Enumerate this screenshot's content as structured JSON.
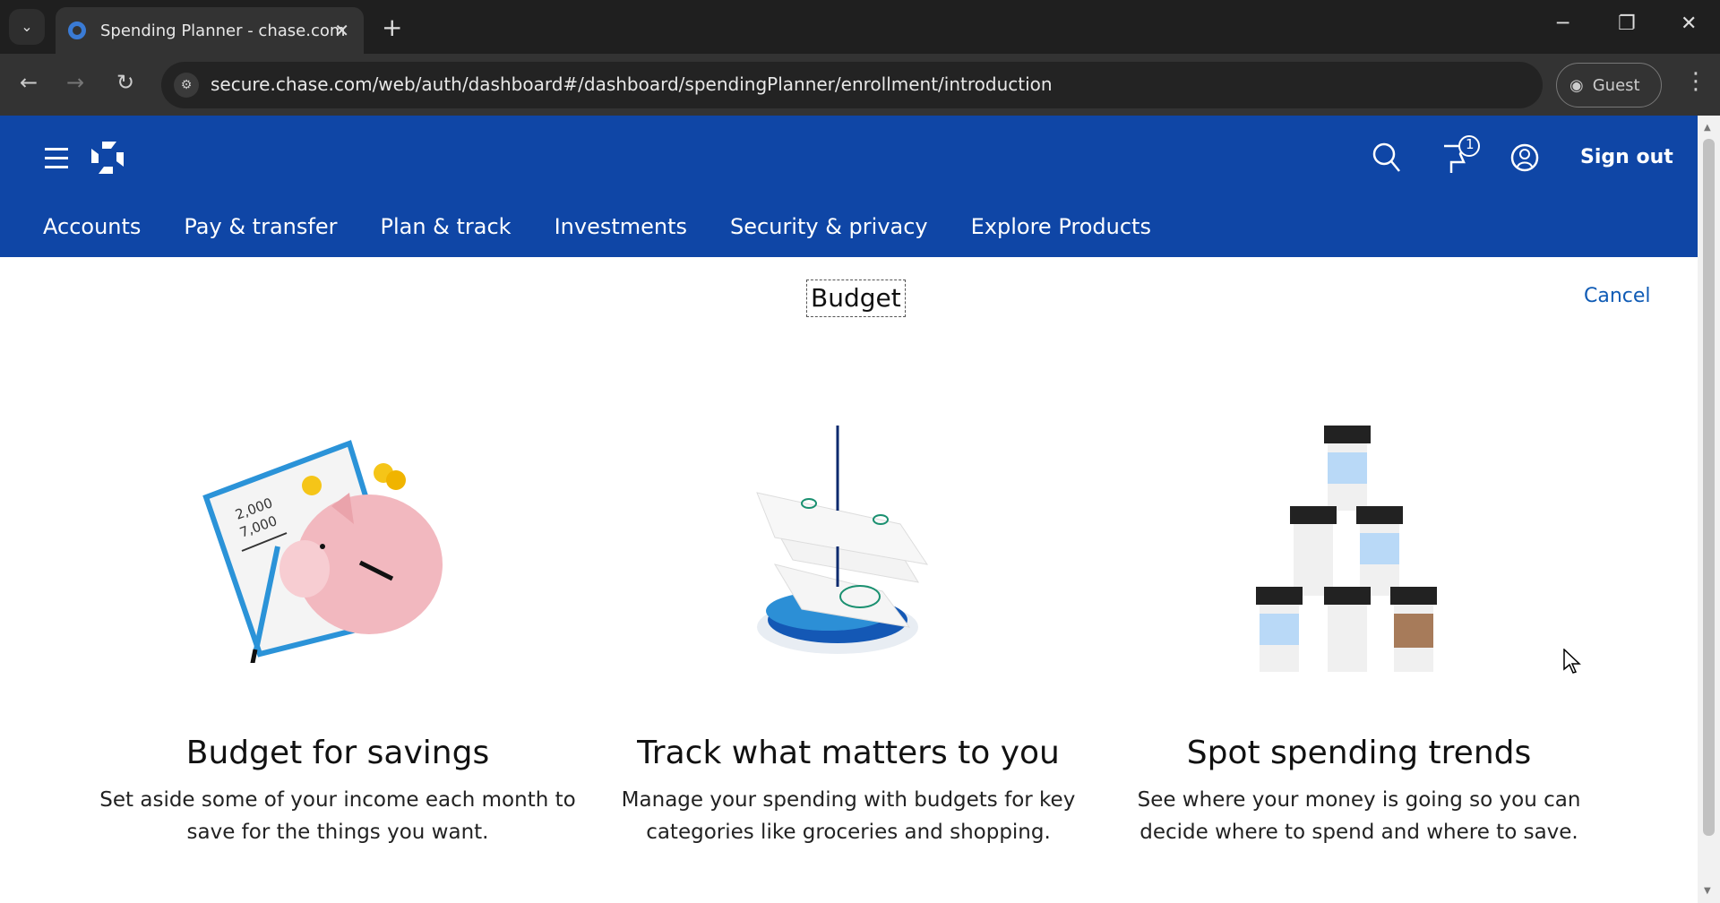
{
  "browser": {
    "tab_title": "Spending Planner - chase.com",
    "url": "secure.chase.com/web/auth/dashboard#/dashboard/spendingPlanner/enrollment/introduction",
    "profile_label": "Guest"
  },
  "header": {
    "notification_count": "1",
    "sign_out": "Sign out",
    "nav": [
      "Accounts",
      "Pay & transfer",
      "Plan & track",
      "Investments",
      "Security & privacy",
      "Explore Products"
    ],
    "brand_color": "#0f46a6"
  },
  "page": {
    "title": "Budget",
    "cancel": "Cancel",
    "features": [
      {
        "heading": "Budget for savings",
        "body": "Set aside some of your income each month to save for the things you want.",
        "illustration_text": [
          "2,000",
          "7,000"
        ]
      },
      {
        "heading": "Track what matters to you",
        "body": "Manage your spending with budgets for key categories like groceries and shopping."
      },
      {
        "heading": "Spot spending trends",
        "body": "See where your money is going so you can decide where to spend and where to save."
      }
    ]
  }
}
